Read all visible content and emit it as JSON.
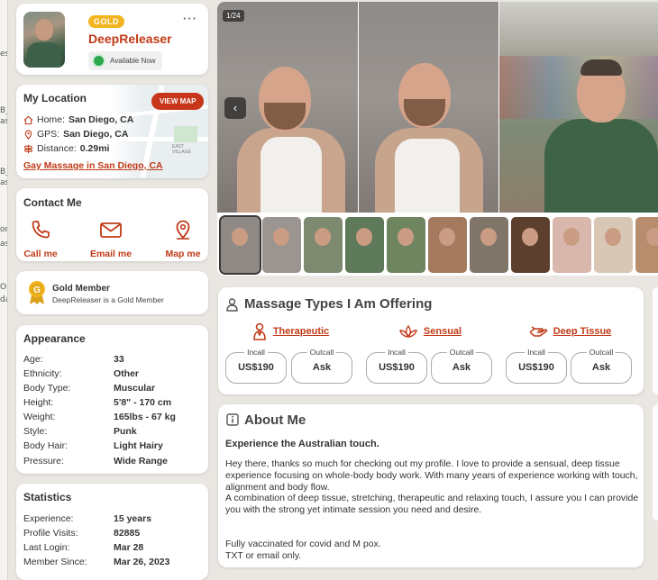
{
  "edge_fragments": [
    "es",
    "B_",
    "as",
    "B_",
    "as",
    "or",
    "as",
    "Or",
    "da"
  ],
  "profile": {
    "badge": "GOLD",
    "username": "DeepReleaser",
    "status": "Available Now",
    "more": "···",
    "status_color": "#2ea64c"
  },
  "location": {
    "title": "My Location",
    "view_map": "VIEW MAP",
    "home_label": "Home:",
    "home_value": "San Diego, CA",
    "gps_label": "GPS:",
    "gps_value": "San Diego, CA",
    "distance_label": "Distance:",
    "distance_value": "0.29mi",
    "link": "Gay Massage in San Diego, CA",
    "map_labels": [
      "EAST VILLAGE"
    ]
  },
  "contact": {
    "title": "Contact Me",
    "items": [
      {
        "label": "Call me",
        "icon": "phone-icon"
      },
      {
        "label": "Email me",
        "icon": "mail-icon"
      },
      {
        "label": "Map me",
        "icon": "map-pin-icon"
      }
    ]
  },
  "gold_member": {
    "medal_letter": "G",
    "title": "Gold Member",
    "subtitle": "DeepReleaser is a Gold Member"
  },
  "appearance": {
    "title": "Appearance",
    "rows": [
      {
        "key": "Age:",
        "value": "33"
      },
      {
        "key": "Ethnicity:",
        "value": "Other"
      },
      {
        "key": "Body Type:",
        "value": "Muscular"
      },
      {
        "key": "Height:",
        "value": "5'8\" - 170 cm"
      },
      {
        "key": "Weight:",
        "value": "165lbs - 67 kg"
      },
      {
        "key": "Style:",
        "value": "Punk"
      },
      {
        "key": "Body Hair:",
        "value": "Light Hairy"
      },
      {
        "key": "Pressure:",
        "value": "Wide Range"
      }
    ]
  },
  "statistics": {
    "title": "Statistics",
    "rows": [
      {
        "key": "Experience:",
        "value": "15 years"
      },
      {
        "key": "Profile Visits:",
        "value": "82885"
      },
      {
        "key": "Last Login:",
        "value": "Mar 28"
      },
      {
        "key": "Member Since:",
        "value": "Mar 26, 2023"
      }
    ]
  },
  "gallery": {
    "counter": "1/24",
    "prev": "‹"
  },
  "massage_types": {
    "title": "Massage Types I Am Offering",
    "types": [
      {
        "name": "Therapeutic",
        "icon": "therapist-icon",
        "incall_label": "Incall",
        "incall": "US$190",
        "outcall_label": "Outcall",
        "outcall": "Ask"
      },
      {
        "name": "Sensual",
        "icon": "lotus-icon",
        "incall_label": "Incall",
        "incall": "US$190",
        "outcall_label": "Outcall",
        "outcall": "Ask"
      },
      {
        "name": "Deep Tissue",
        "icon": "massage-hand-icon",
        "incall_label": "Incall",
        "incall": "US$190",
        "outcall_label": "Outcall",
        "outcall": "Ask"
      }
    ]
  },
  "about": {
    "title": "About Me",
    "headline": "Experience the Australian touch.",
    "para1": "Hey there, thanks so much for checking out my profile. I love to provide a sensual, deep tissue experience focusing on whole-body body work. With many years of experience working with touch, alignment and body flow.",
    "para2": "A combination of deep tissue, stretching, therapeutic and relaxing touch, I assure you I can provide you with the strong yet intimate session you need and desire.",
    "para3": "Fully vaccinated for covid and M pox.",
    "para4": "TXT or email only."
  },
  "colors": {
    "accent": "#c03a17",
    "gold": "#f2b51f",
    "background": "#eae7e2"
  }
}
